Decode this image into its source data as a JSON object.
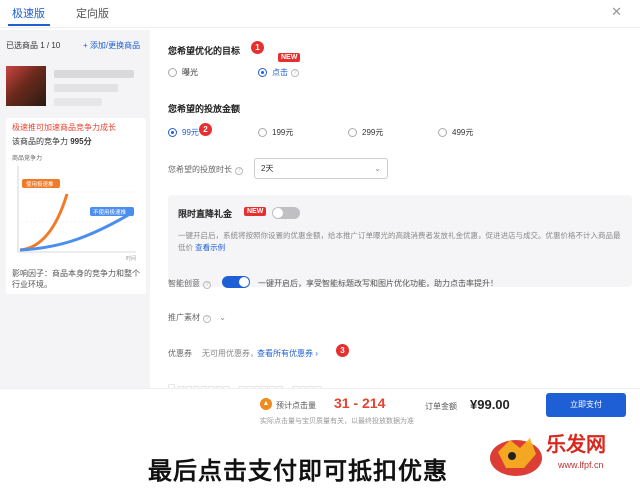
{
  "tabs": [
    {
      "label": "极速版",
      "active": true
    },
    {
      "label": "定向版",
      "active": false
    }
  ],
  "close_icon": "close-icon",
  "sidebar": {
    "selected_count": "已选商品 1 / 10",
    "add_link": "+ 添加/更换商品",
    "card": {
      "title": "极速推可加速商品竞争力成长",
      "score_label": "该商品的竞争力",
      "score_value": "995分",
      "chart_label": "商品竞争力",
      "tag_used": "使用极速推",
      "tag_unused": "不使用极速推",
      "x_label": "时间",
      "footnote": "影响因子：商品本身的竞争力和整个行业环境。"
    }
  },
  "goal": {
    "title": "您希望优化的目标",
    "badge": "1",
    "options": [
      {
        "label": "曝光",
        "checked": false
      },
      {
        "label": "点击",
        "checked": true
      }
    ],
    "new_tag": "NEW"
  },
  "budget": {
    "title": "您希望的投放金额",
    "badge": "2",
    "options": [
      {
        "label": "99元",
        "checked": true
      },
      {
        "label": "199元",
        "checked": false
      },
      {
        "label": "299元",
        "checked": false
      },
      {
        "label": "499元",
        "checked": false
      }
    ]
  },
  "duration": {
    "label": "您希望的投放时长",
    "value": "2天"
  },
  "gift_panel": {
    "title": "限时直降礼金",
    "new_tag": "NEW",
    "toggle_on": false,
    "desc": "一键开启后，系统将按照你设置的优惠金额，给本推广订单曝光的高跳消费者发放礼金优惠，促进进店与成交。优惠价格不计入商品最低价",
    "link": "查看示例"
  },
  "smart": {
    "label": "智能创意",
    "toggle_on": true,
    "desc": "一键开启后，享受智能标题改写和图片优化功能，助力点击率提升！"
  },
  "material": {
    "label": "推广素材"
  },
  "coupon": {
    "label": "优惠券",
    "text": "无可用优惠券，",
    "link": "查看所有优惠券",
    "badge": "3"
  },
  "bottom": {
    "est_label": "预计点击量",
    "est_range": "31 - 214",
    "est_note": "实际点击量与宝贝质量有关，以最终投放数据为准",
    "pay_label": "订单金额",
    "pay_value": "¥99.00",
    "pay_button": "立即支付"
  },
  "caption": "最后点击支付即可抵扣优惠",
  "watermark": {
    "name": "乐发网",
    "url": "www.lfpf.cn"
  },
  "colors": {
    "accent": "#1f5fd6",
    "danger": "#e5302f",
    "orange": "#f08a1c"
  }
}
